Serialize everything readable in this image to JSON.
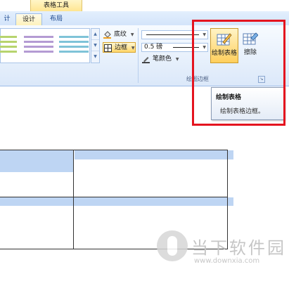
{
  "ribbon": {
    "context_tab_header": "表格工具",
    "tabs": [
      {
        "label": "计",
        "partial": true
      },
      {
        "label": "设计",
        "active": true
      },
      {
        "label": "布局",
        "active": false
      }
    ],
    "shading_label": "底纹",
    "borders_label": "边框",
    "line_weight_value": "0.5 磅",
    "pen_color_label": "笔颜色",
    "draw_table_label": "绘制表格",
    "eraser_label": "擦除",
    "group_draw_borders_label": "绘图边框"
  },
  "tooltip": {
    "title": "绘制表格",
    "description": "绘制表格边框。"
  },
  "watermark": {
    "chinese": "当下软件园",
    "url": "www.downxia.com"
  },
  "colors": {
    "highlight": "#e4141f",
    "ribbon_bg": "#dbe8f9",
    "active_button": "#ffcf5c",
    "table_shade": "#bed5f3"
  },
  "icons": {
    "shading": "paint-bucket-icon",
    "borders": "border-grid-icon",
    "pen_color": "pen-icon",
    "draw_table": "draw-table-pencil-icon",
    "eraser": "eraser-icon",
    "launcher": "dialog-launcher-icon"
  }
}
